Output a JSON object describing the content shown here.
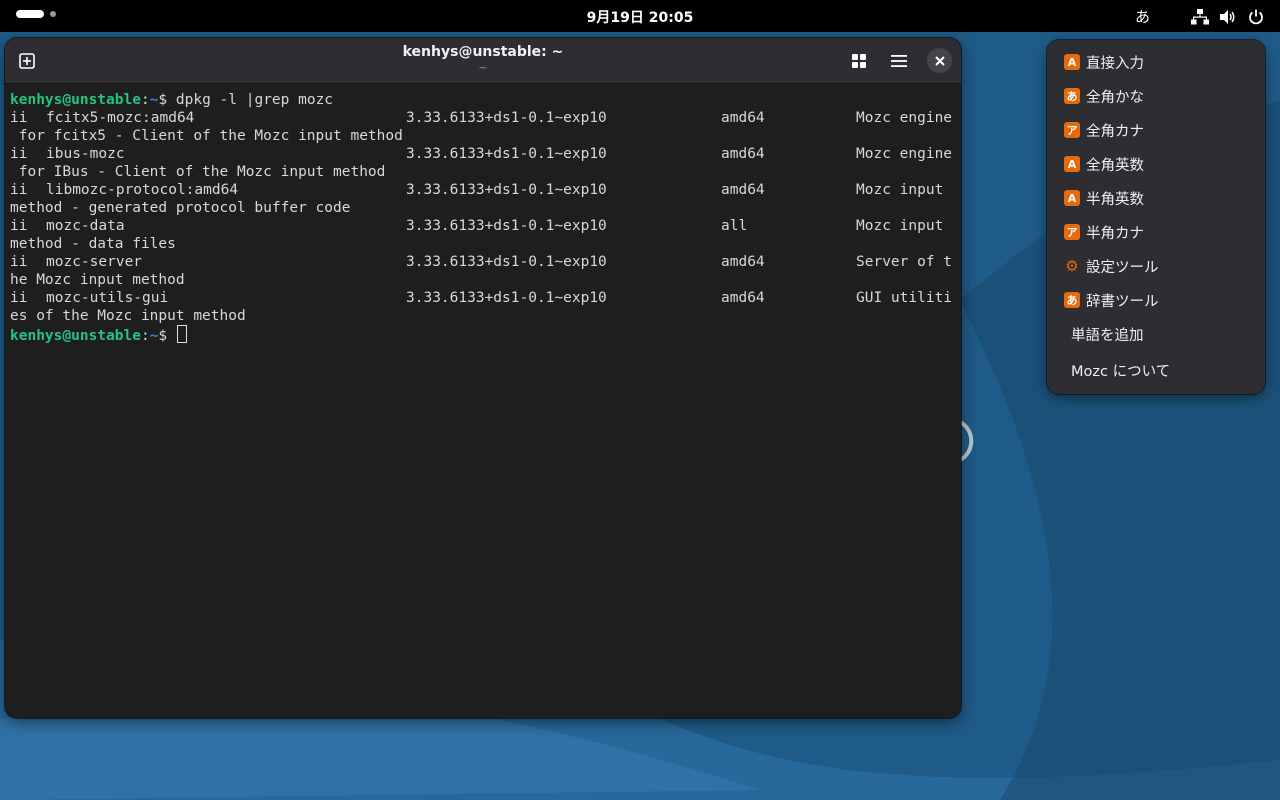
{
  "topbar": {
    "clock": "9月19日  20:05",
    "ime_indicator": "あ",
    "icons": [
      "network-icon",
      "volume-icon",
      "power-icon"
    ]
  },
  "window": {
    "title": "kenhys@unstable: ~",
    "subtitle": "~"
  },
  "terminal": {
    "prompt_user": "kenhys@unstable",
    "prompt_sep": ":",
    "prompt_dir": "~",
    "prompt_dollar": "$ ",
    "command": "dpkg -l |grep mozc",
    "packages": [
      {
        "status": "ii",
        "name": "fcitx5-mozc:amd64",
        "version": "3.33.6133+ds1-0.1~exp10",
        "arch": "amd64",
        "desc1": "Mozc engine",
        "desc2": " for fcitx5 - Client of the Mozc input method"
      },
      {
        "status": "ii",
        "name": "ibus-mozc",
        "version": "3.33.6133+ds1-0.1~exp10",
        "arch": "amd64",
        "desc1": "Mozc engine",
        "desc2": " for IBus - Client of the Mozc input method"
      },
      {
        "status": "ii",
        "name": "libmozc-protocol:amd64",
        "version": "3.33.6133+ds1-0.1~exp10",
        "arch": "amd64",
        "desc1": "Mozc input",
        "desc2": "method - generated protocol buffer code"
      },
      {
        "status": "ii",
        "name": "mozc-data",
        "version": "3.33.6133+ds1-0.1~exp10",
        "arch": "all",
        "desc1": "Mozc input",
        "desc2": "method - data files"
      },
      {
        "status": "ii",
        "name": "mozc-server",
        "version": "3.33.6133+ds1-0.1~exp10",
        "arch": "amd64",
        "desc1": "Server of t",
        "desc2": "he Mozc input method"
      },
      {
        "status": "ii",
        "name": "mozc-utils-gui",
        "version": "3.33.6133+ds1-0.1~exp10",
        "arch": "amd64",
        "desc1": "GUI utiliti",
        "desc2": "es of the Mozc input method"
      }
    ]
  },
  "ime_menu": {
    "items": [
      {
        "icon": "A",
        "label": "直接入力"
      },
      {
        "icon": "あ",
        "label": "全角かな"
      },
      {
        "icon": "ア",
        "label": "全角カナ"
      },
      {
        "icon": "A",
        "label": "全角英数"
      },
      {
        "icon": "A",
        "label": "半角英数"
      },
      {
        "icon": "ア",
        "label": "半角カナ"
      },
      {
        "icon": "⚙",
        "label": "設定ツール"
      },
      {
        "icon": "あ",
        "label": "辞書ツール"
      },
      {
        "icon": "",
        "label": "単語を追加"
      },
      {
        "icon": "",
        "label": "Mozc について"
      }
    ]
  },
  "colors": {
    "accent": "#e66b0f",
    "prompt_user": "#26c281",
    "prompt_dir": "#3584e4"
  }
}
